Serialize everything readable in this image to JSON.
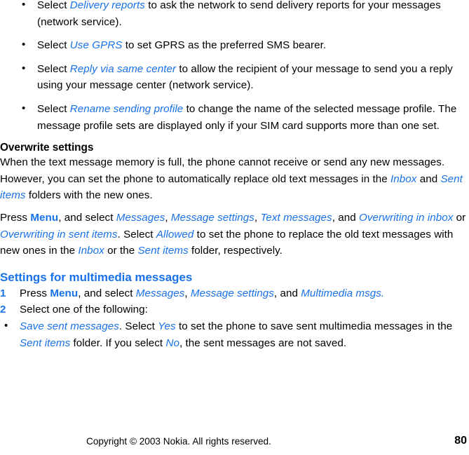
{
  "document": {
    "title": "Nokia user guide page 80",
    "accent_blue": "#1a72e8",
    "text_color": "#000000",
    "background": "#ffffff"
  },
  "bullets_top": [
    {
      "seg": [
        {
          "t": "Select ",
          "s": "plain"
        },
        {
          "t": "Delivery reports",
          "s": "ui"
        },
        {
          "t": " to ask the network to send delivery reports for your messages (network service).",
          "s": "plain"
        }
      ]
    },
    {
      "seg": [
        {
          "t": "Select ",
          "s": "plain"
        },
        {
          "t": "Use GPRS",
          "s": "ui"
        },
        {
          "t": " to set GPRS as the preferred SMS bearer.",
          "s": "plain"
        }
      ]
    },
    {
      "seg": [
        {
          "t": "Select ",
          "s": "plain"
        },
        {
          "t": "Reply via same center",
          "s": "ui"
        },
        {
          "t": " to allow the recipient of your message to send you a reply using your message center (network service).",
          "s": "plain"
        }
      ]
    },
    {
      "seg": [
        {
          "t": "Select ",
          "s": "plain"
        },
        {
          "t": "Rename sending profile",
          "s": "ui"
        },
        {
          "t": " to change the name of the selected message profile. The message profile sets are displayed only if your SIM card supports more than one set.",
          "s": "plain"
        }
      ]
    }
  ],
  "overwrite_section": {
    "heading": "Overwrite settings",
    "paragraph_1": [
      {
        "t": "When the text message memory is full, the phone cannot receive or send any new messages. However, you can set the phone to automatically replace old text messages in the ",
        "s": "plain"
      },
      {
        "t": "Inbox",
        "s": "ui"
      },
      {
        "t": " and ",
        "s": "plain"
      },
      {
        "t": "Sent items",
        "s": "ui"
      },
      {
        "t": " folders with the new ones.",
        "s": "plain"
      }
    ],
    "paragraph_2": [
      {
        "t": "Press ",
        "s": "plain"
      },
      {
        "t": "Menu",
        "s": "key"
      },
      {
        "t": ", and select ",
        "s": "plain"
      },
      {
        "t": "Messages",
        "s": "ui"
      },
      {
        "t": ", ",
        "s": "plain"
      },
      {
        "t": "Message settings",
        "s": "ui"
      },
      {
        "t": ", ",
        "s": "plain"
      },
      {
        "t": "Text messages",
        "s": "ui"
      },
      {
        "t": ", and ",
        "s": "plain"
      },
      {
        "t": "Overwriting in inbox",
        "s": "ui"
      },
      {
        "t": " or ",
        "s": "plain"
      },
      {
        "t": "Overwriting in sent items",
        "s": "ui"
      },
      {
        "t": ". Select ",
        "s": "plain"
      },
      {
        "t": "Allowed",
        "s": "ui"
      },
      {
        "t": " to set the phone to replace the old text messages with new ones in the ",
        "s": "plain"
      },
      {
        "t": "Inbox",
        "s": "ui"
      },
      {
        "t": " or the ",
        "s": "plain"
      },
      {
        "t": "Sent items",
        "s": "ui"
      },
      {
        "t": " folder, respectively.",
        "s": "plain"
      }
    ]
  },
  "multimedia_section": {
    "heading": "Settings for multimedia messages",
    "items": [
      {
        "marker": "1",
        "type": "number",
        "seg": [
          {
            "t": "Press ",
            "s": "plain"
          },
          {
            "t": "Menu",
            "s": "key"
          },
          {
            "t": ", and select ",
            "s": "plain"
          },
          {
            "t": "Messages",
            "s": "ui"
          },
          {
            "t": ", ",
            "s": "plain"
          },
          {
            "t": "Message settings",
            "s": "ui"
          },
          {
            "t": ", and ",
            "s": "plain"
          },
          {
            "t": "Multimedia msgs.",
            "s": "ui"
          }
        ]
      },
      {
        "marker": "2",
        "type": "number",
        "seg": [
          {
            "t": "Select one of the following:",
            "s": "plain"
          }
        ]
      },
      {
        "marker": "",
        "type": "bullet",
        "seg": [
          {
            "t": "Save sent messages",
            "s": "ui"
          },
          {
            "t": ". Select ",
            "s": "plain"
          },
          {
            "t": "Yes",
            "s": "ui"
          },
          {
            "t": " to set the phone to save sent multimedia messages in the ",
            "s": "plain"
          },
          {
            "t": "Sent items",
            "s": "ui"
          },
          {
            "t": " folder. If you select ",
            "s": "plain"
          },
          {
            "t": "No",
            "s": "ui"
          },
          {
            "t": ", the sent messages are not saved.",
            "s": "plain"
          }
        ]
      }
    ]
  },
  "footer": {
    "copyright": "Copyright © 2003 Nokia. All rights reserved.",
    "page_number": "80"
  }
}
